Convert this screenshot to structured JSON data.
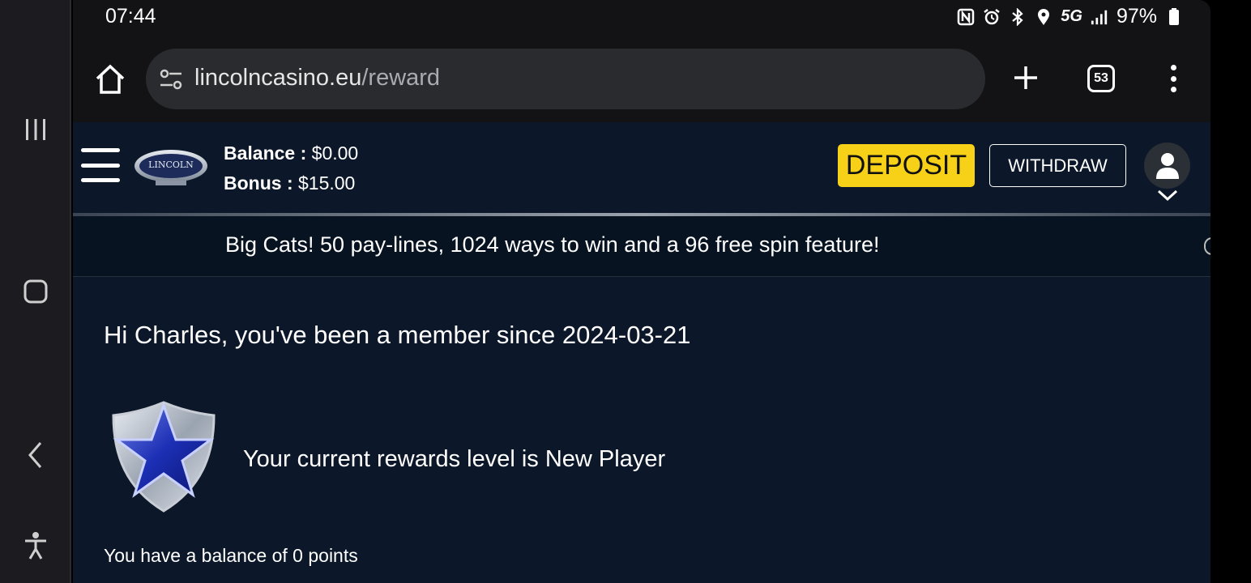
{
  "status_bar": {
    "time": "07:44",
    "network": "5G",
    "battery": "97%",
    "icons": [
      "nfc-icon",
      "alarm-icon",
      "bluetooth-icon",
      "location-icon",
      "5g-icon",
      "signal-icon",
      "battery-icon"
    ]
  },
  "browser": {
    "url_domain": "lincolncasino.eu",
    "url_path": "/reward",
    "tab_count": "53"
  },
  "site_header": {
    "balance_label": "Balance :",
    "balance_value": "$0.00",
    "bonus_label": "Bonus :",
    "bonus_value": "$15.00",
    "deposit_label": "DEPOSIT",
    "withdraw_label": "WITHDRAW",
    "logo_text": "LINCOLN"
  },
  "ticker": {
    "text": "Big Cats! 50 pay-lines, 1024 ways to win and a 96 free spin feature!"
  },
  "rewards": {
    "greeting": "Hi Charles, you've been a member since 2024-03-21",
    "level_text": "Your current rewards level is New Player",
    "points_text": "You have a balance of 0 points"
  },
  "colors": {
    "page_bg": "#0c1829",
    "deposit_bg": "#f7d117",
    "chrome_bg": "#131316",
    "urlbar_bg": "#2a2b2f"
  }
}
